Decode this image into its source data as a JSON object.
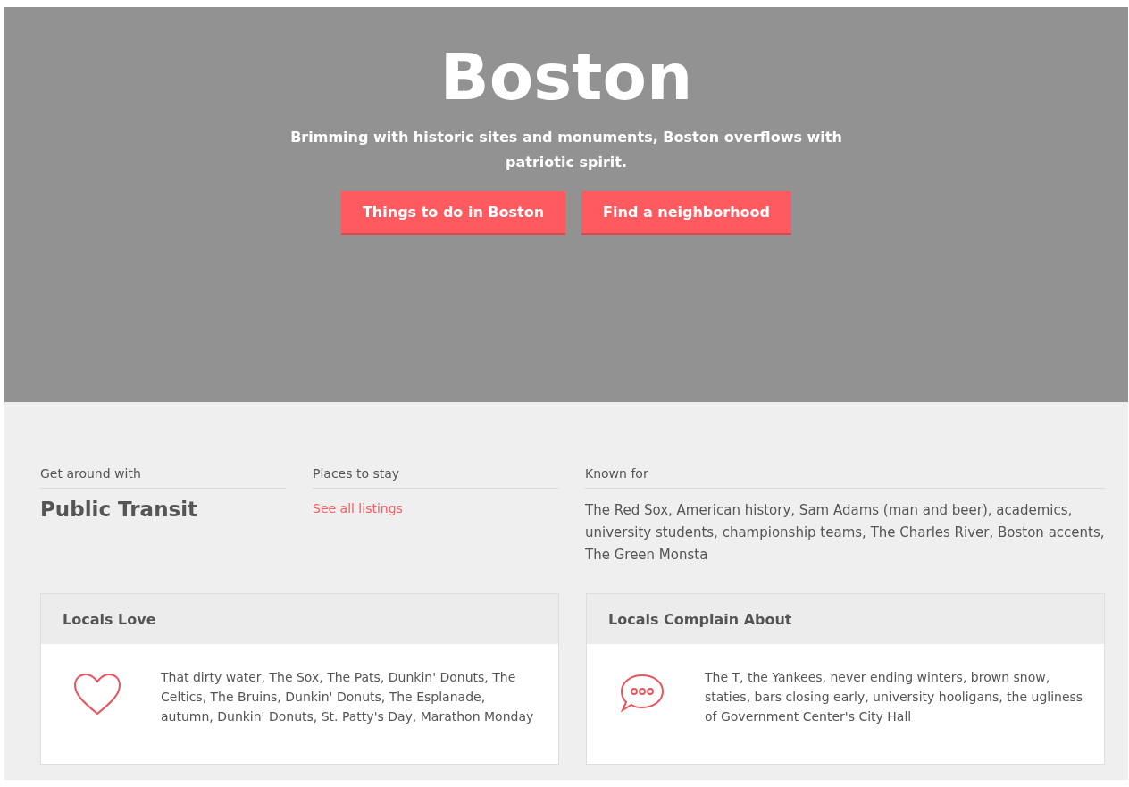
{
  "hero": {
    "title": "Boston",
    "subtitle": "Brimming with historic sites and monuments, Boston overflows with patriotic spirit.",
    "buttons": [
      "Things to do in Boston",
      "Find a neighborhood"
    ]
  },
  "facts": [
    {
      "label": "Get around with",
      "kind": "value",
      "text": "Public Transit"
    },
    {
      "label": "Places to stay",
      "kind": "link",
      "text": "See all listings"
    },
    {
      "label": "Known for",
      "kind": "text",
      "text": "The Red Sox, American history, Sam Adams (man and beer), academics, university students, championship teams, The Charles River, Boston accents, The Green Monsta"
    }
  ],
  "cards": [
    {
      "title": "Locals Love",
      "kind": "heart",
      "text": "That dirty water, The Sox, The Pats, Dunkin' Donuts, The Celtics, The Bruins, Dunkin' Donuts, The Esplanade, autumn, Dunkin' Donuts, St. Patty's Day, Marathon Monday"
    },
    {
      "title": "Locals Complain About",
      "kind": "speech",
      "text": "The T, the Yankees, never ending winters, brown snow, staties, bars closing early, university hooligans, the ugliness of Government Center's City Hall"
    }
  ]
}
